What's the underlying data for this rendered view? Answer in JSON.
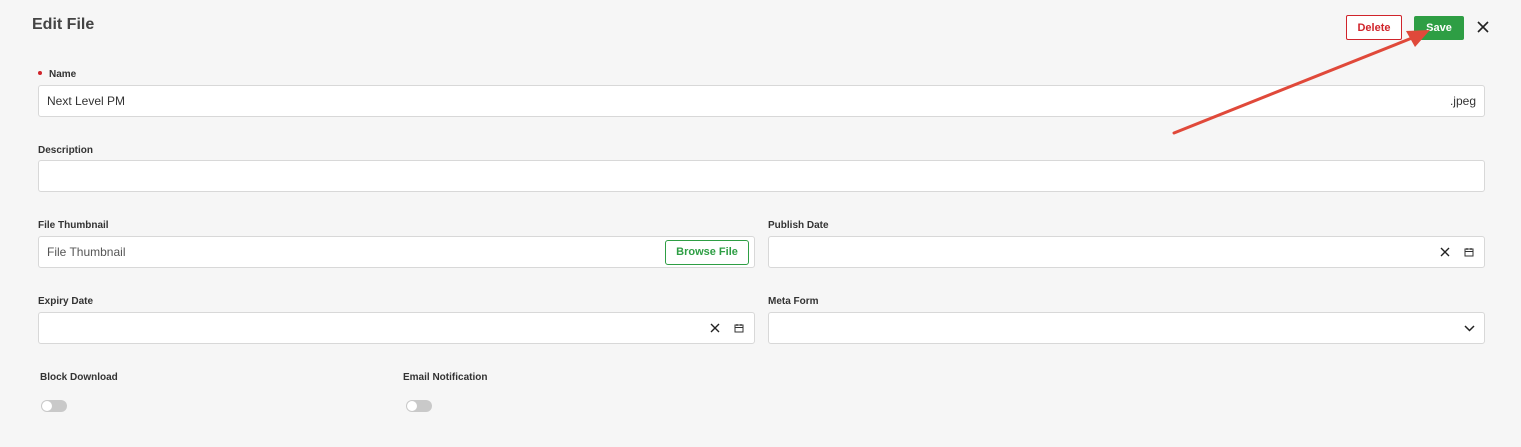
{
  "header": {
    "title": "Edit File",
    "delete_label": "Delete",
    "save_label": "Save"
  },
  "form": {
    "name": {
      "label": "Name",
      "value": "Next Level PM",
      "suffix": ".jpeg",
      "required": true
    },
    "description": {
      "label": "Description",
      "value": ""
    },
    "file_thumbnail": {
      "label": "File Thumbnail",
      "placeholder": "File Thumbnail",
      "browse_label": "Browse File"
    },
    "publish_date": {
      "label": "Publish Date",
      "value": ""
    },
    "expiry_date": {
      "label": "Expiry Date",
      "value": ""
    },
    "meta_form": {
      "label": "Meta Form",
      "value": ""
    },
    "block_download": {
      "label": "Block Download",
      "enabled": false
    },
    "email_notification": {
      "label": "Email Notification",
      "enabled": false
    }
  },
  "colors": {
    "accent_green": "#2e9e44",
    "danger_red": "#d0242b",
    "annotation_arrow": "#e0493a"
  },
  "icons": {
    "close": "close-icon",
    "clear": "clear-icon",
    "calendar": "calendar-icon",
    "dropdown": "chevron-down-icon"
  }
}
